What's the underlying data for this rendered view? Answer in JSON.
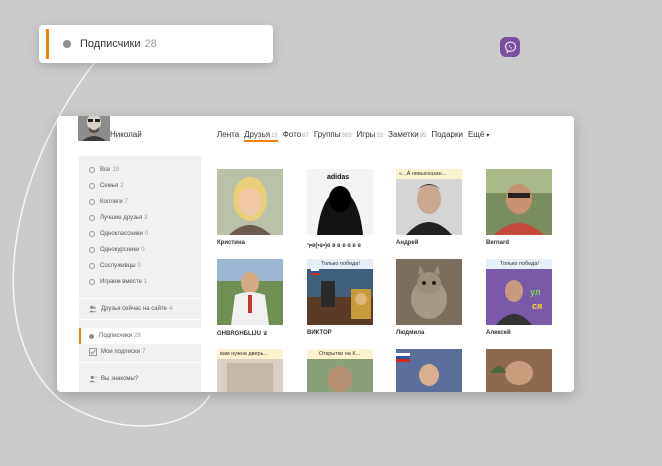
{
  "colors": {
    "accent": "#ee8208",
    "viber": "#7b519d"
  },
  "floating_card": {
    "label": "Подписчики",
    "count": "28"
  },
  "profile": {
    "name": "Николай",
    "avatar_icon": "user-avatar-icon"
  },
  "tabs": [
    {
      "label": "Лента",
      "count": ""
    },
    {
      "label": "Друзья",
      "count": "19"
    },
    {
      "label": "Фото",
      "count": "87"
    },
    {
      "label": "Группы",
      "count": "369"
    },
    {
      "label": "Игры",
      "count": "33"
    },
    {
      "label": "Заметки",
      "count": "95"
    },
    {
      "label": "Подарки",
      "count": ""
    },
    {
      "label": "Ещё",
      "count": "",
      "caret": "▾"
    }
  ],
  "sidebar": {
    "filters": [
      {
        "label": "Все",
        "count": "19"
      },
      {
        "label": "Семья",
        "count": "2"
      },
      {
        "label": "Коллеги",
        "count": "7"
      },
      {
        "label": "Лучшие друзья",
        "count": "3"
      },
      {
        "label": "Одноклассники",
        "count": "0"
      },
      {
        "label": "Однокурсники",
        "count": "0"
      },
      {
        "label": "Сослуживцы",
        "count": "0"
      },
      {
        "label": "Играем вместе",
        "count": "1"
      }
    ],
    "online": {
      "label": "Друзья сейчас на сайте",
      "count": "4"
    },
    "subscribers": {
      "label": "Подписчики",
      "count": "28"
    },
    "my_subscriptions": {
      "label": "Мои подписки",
      "count": "7"
    },
    "maybe_know": {
      "label": "Вы знакомы?"
    }
  },
  "friends": [
    {
      "name": "Кристина",
      "banner": ""
    },
    {
      "name": "ๅ•ʚ(•ɞ•)ɞ ʚ ɞ ʚ ɞ ʚ ɞ",
      "banner": ""
    },
    {
      "name": "Андрей",
      "banner": "«...А невысказан..."
    },
    {
      "name": "Bernard",
      "banner": ""
    },
    {
      "name": "GHBRGHБLIJU ♛",
      "banner": ""
    },
    {
      "name": "ВИКТОР",
      "banner": "Только победа!"
    },
    {
      "name": "Людмила",
      "banner": ""
    },
    {
      "name": "Алексей",
      "banner": "Только победа!"
    },
    {
      "name": "",
      "banner": "вам нужна дверь..."
    },
    {
      "name": "",
      "banner": "Открытки на К..."
    },
    {
      "name": "",
      "banner": ""
    },
    {
      "name": "",
      "banner": ""
    }
  ],
  "photo_texts": {
    "adidas": "adidas"
  }
}
